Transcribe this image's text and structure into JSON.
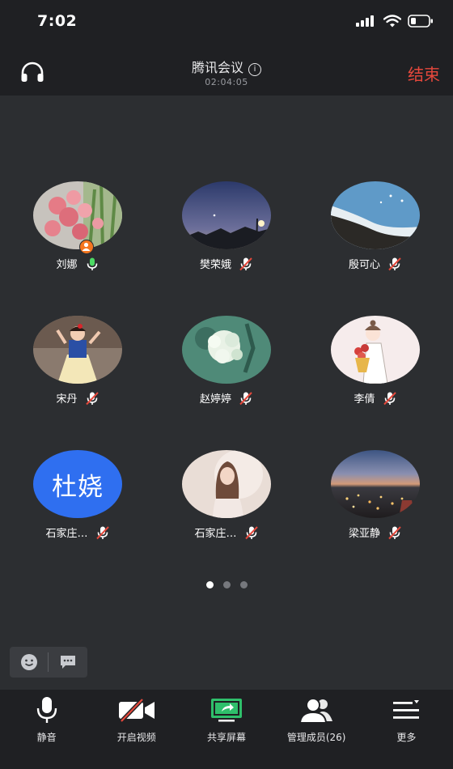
{
  "status_bar": {
    "time": "7:02"
  },
  "header": {
    "title": "腾讯会议",
    "info_glyph": "i",
    "timer": "02:04:05",
    "end_label": "结束",
    "accent_color": "#e5483c"
  },
  "participants": [
    {
      "name": "刘娜",
      "mic": "on",
      "avatar": "flowers-photo",
      "host": true
    },
    {
      "name": "樊荣娥",
      "mic": "muted",
      "avatar": "night-sky-photo"
    },
    {
      "name": "殷可心",
      "mic": "muted",
      "avatar": "beach-photo"
    },
    {
      "name": "宋丹",
      "mic": "muted",
      "avatar": "child-photo"
    },
    {
      "name": "赵婷婷",
      "mic": "muted",
      "avatar": "hydrangea-photo"
    },
    {
      "name": "李倩",
      "mic": "muted",
      "avatar": "illustration-photo"
    },
    {
      "name": "石家庄…",
      "mic": "muted",
      "avatar": "text-avatar",
      "avatar_text": "杜娆",
      "avatar_color": "#2f6ff0"
    },
    {
      "name": "石家庄…",
      "mic": "muted",
      "avatar": "portrait-photo"
    },
    {
      "name": "梁亚静",
      "mic": "muted",
      "avatar": "city-night-photo"
    }
  ],
  "pager": {
    "pages": 3,
    "active": 0
  },
  "toolbar": {
    "mute_label": "静音",
    "video_label": "开启视频",
    "share_label": "共享屏幕",
    "members_label": "管理成员(26)",
    "more_label": "更多",
    "share_icon_color": "#2fbf6b"
  },
  "colors": {
    "background": "#2c2e31",
    "bar": "#1f2023",
    "mic_on": "#4cd964",
    "mic_muted": "#e5483c"
  }
}
